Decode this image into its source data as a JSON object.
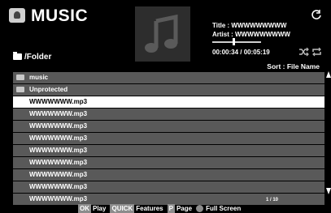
{
  "header": {
    "app_title": "MUSIC",
    "folder_label": "/Folder",
    "sort_label": "Sort : File Name"
  },
  "now_playing": {
    "title_line": "Title : WWWWWWWWW",
    "artist_line": "Artist : WWWWWWWWW",
    "time": "00:00:34 / 00:05:19",
    "progress": 0.43
  },
  "list": {
    "folders": [
      {
        "label": "music"
      },
      {
        "label": "Unprotected"
      }
    ],
    "files": [
      {
        "label": "WWWWWWW.mp3"
      },
      {
        "label": "WWWWWWW.mp3"
      },
      {
        "label": "WWWWWWW.mp3"
      },
      {
        "label": "WWWWWWW.mp3"
      },
      {
        "label": "WWWWWWW.mp3"
      },
      {
        "label": "WWWWWWW.mp3"
      },
      {
        "label": "WWWWWWW.mp3"
      },
      {
        "label": "WWWWWWW.mp3"
      },
      {
        "label": "WWWWWWW.mp3"
      }
    ],
    "page": "1 / 10"
  },
  "footer": {
    "ok_key": "OK",
    "ok_label": "Play",
    "quick_key": "QUICK",
    "quick_label": "Features",
    "p_key": "P",
    "p_label": "Page",
    "fullscreen_label": "Full Screen"
  },
  "colors": {
    "background": "#000000",
    "row": "#595959",
    "row_selected": "#ffffff",
    "key": "#8c8c8c"
  },
  "icons": [
    "music-app-icon",
    "folder-icon",
    "music-note-icon",
    "refresh-icon",
    "shuffle-icon",
    "repeat-icon",
    "scroll-up-icon",
    "scroll-down-icon"
  ]
}
